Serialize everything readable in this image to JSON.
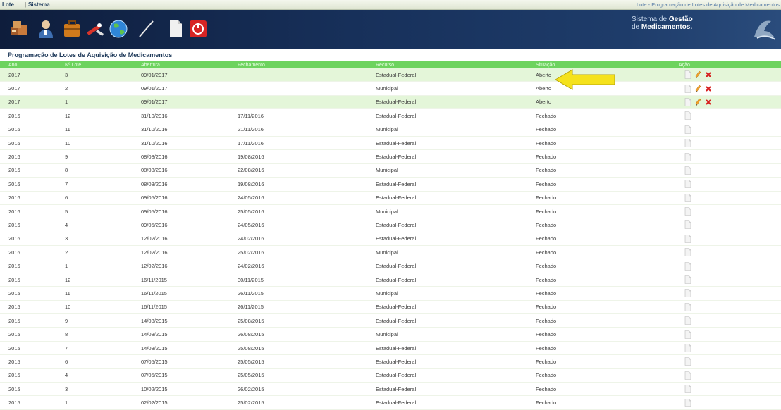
{
  "menu": {
    "items": [
      "Lote",
      "Sistema"
    ],
    "separator": "|"
  },
  "breadcrumb": "Lote - Programação de Lotes de Aquisição de Medicamentos",
  "brand": {
    "line1a": "Sistema de ",
    "line1b": "Gestão",
    "line2a": "de ",
    "line2b": "Medicamentos."
  },
  "toolbar": [
    "boxes-icon",
    "user-icon",
    "briefcase-icon",
    "tools-icon",
    "globe-icon",
    "pen-icon",
    "document-icon",
    "power-icon"
  ],
  "page_title": "Programação de Lotes de Aquisição de Medicamentos",
  "table": {
    "headers": [
      "Ano",
      "Nº Lote",
      "Abertura",
      "Fechamento",
      "Recurso",
      "Situação",
      "Ação"
    ],
    "rows": [
      {
        "ano": "2017",
        "lote": "3",
        "abertura": "09/01/2017",
        "fechamento": "",
        "recurso": "Estadual-Federal",
        "situacao": "Aberto",
        "acoes": [
          "doc",
          "edit",
          "delete"
        ],
        "hl": true
      },
      {
        "ano": "2017",
        "lote": "2",
        "abertura": "09/01/2017",
        "fechamento": "",
        "recurso": "Municipal",
        "situacao": "Aberto",
        "acoes": [
          "doc",
          "edit",
          "delete"
        ],
        "hl": false
      },
      {
        "ano": "2017",
        "lote": "1",
        "abertura": "09/01/2017",
        "fechamento": "",
        "recurso": "Estadual-Federal",
        "situacao": "Aberto",
        "acoes": [
          "doc",
          "edit",
          "delete"
        ],
        "hl": true
      },
      {
        "ano": "2016",
        "lote": "12",
        "abertura": "31/10/2016",
        "fechamento": "17/11/2016",
        "recurso": "Estadual-Federal",
        "situacao": "Fechado",
        "acoes": [
          "doc"
        ],
        "hl": false
      },
      {
        "ano": "2016",
        "lote": "11",
        "abertura": "31/10/2016",
        "fechamento": "21/11/2016",
        "recurso": "Municipal",
        "situacao": "Fechado",
        "acoes": [
          "doc"
        ],
        "hl": false
      },
      {
        "ano": "2016",
        "lote": "10",
        "abertura": "31/10/2016",
        "fechamento": "17/11/2016",
        "recurso": "Estadual-Federal",
        "situacao": "Fechado",
        "acoes": [
          "doc"
        ],
        "hl": false
      },
      {
        "ano": "2016",
        "lote": "9",
        "abertura": "08/08/2016",
        "fechamento": "19/08/2016",
        "recurso": "Estadual-Federal",
        "situacao": "Fechado",
        "acoes": [
          "doc"
        ],
        "hl": false
      },
      {
        "ano": "2016",
        "lote": "8",
        "abertura": "08/08/2016",
        "fechamento": "22/08/2016",
        "recurso": "Municipal",
        "situacao": "Fechado",
        "acoes": [
          "doc"
        ],
        "hl": false
      },
      {
        "ano": "2016",
        "lote": "7",
        "abertura": "08/08/2016",
        "fechamento": "19/08/2016",
        "recurso": "Estadual-Federal",
        "situacao": "Fechado",
        "acoes": [
          "doc"
        ],
        "hl": false
      },
      {
        "ano": "2016",
        "lote": "6",
        "abertura": "09/05/2016",
        "fechamento": "24/05/2016",
        "recurso": "Estadual-Federal",
        "situacao": "Fechado",
        "acoes": [
          "doc"
        ],
        "hl": false
      },
      {
        "ano": "2016",
        "lote": "5",
        "abertura": "09/05/2016",
        "fechamento": "25/05/2016",
        "recurso": "Municipal",
        "situacao": "Fechado",
        "acoes": [
          "doc"
        ],
        "hl": false
      },
      {
        "ano": "2016",
        "lote": "4",
        "abertura": "09/05/2016",
        "fechamento": "24/05/2016",
        "recurso": "Estadual-Federal",
        "situacao": "Fechado",
        "acoes": [
          "doc"
        ],
        "hl": false
      },
      {
        "ano": "2016",
        "lote": "3",
        "abertura": "12/02/2016",
        "fechamento": "24/02/2016",
        "recurso": "Estadual-Federal",
        "situacao": "Fechado",
        "acoes": [
          "doc"
        ],
        "hl": false
      },
      {
        "ano": "2016",
        "lote": "2",
        "abertura": "12/02/2016",
        "fechamento": "25/02/2016",
        "recurso": "Municipal",
        "situacao": "Fechado",
        "acoes": [
          "doc"
        ],
        "hl": false
      },
      {
        "ano": "2016",
        "lote": "1",
        "abertura": "12/02/2016",
        "fechamento": "24/02/2016",
        "recurso": "Estadual-Federal",
        "situacao": "Fechado",
        "acoes": [
          "doc"
        ],
        "hl": false
      },
      {
        "ano": "2015",
        "lote": "12",
        "abertura": "16/11/2015",
        "fechamento": "30/11/2015",
        "recurso": "Estadual-Federal",
        "situacao": "Fechado",
        "acoes": [
          "doc"
        ],
        "hl": false
      },
      {
        "ano": "2015",
        "lote": "11",
        "abertura": "16/11/2015",
        "fechamento": "26/11/2015",
        "recurso": "Municipal",
        "situacao": "Fechado",
        "acoes": [
          "doc"
        ],
        "hl": false
      },
      {
        "ano": "2015",
        "lote": "10",
        "abertura": "16/11/2015",
        "fechamento": "26/11/2015",
        "recurso": "Estadual-Federal",
        "situacao": "Fechado",
        "acoes": [
          "doc"
        ],
        "hl": false
      },
      {
        "ano": "2015",
        "lote": "9",
        "abertura": "14/08/2015",
        "fechamento": "25/08/2015",
        "recurso": "Estadual-Federal",
        "situacao": "Fechado",
        "acoes": [
          "doc"
        ],
        "hl": false
      },
      {
        "ano": "2015",
        "lote": "8",
        "abertura": "14/08/2015",
        "fechamento": "26/08/2015",
        "recurso": "Municipal",
        "situacao": "Fechado",
        "acoes": [
          "doc"
        ],
        "hl": false
      },
      {
        "ano": "2015",
        "lote": "7",
        "abertura": "14/08/2015",
        "fechamento": "25/08/2015",
        "recurso": "Estadual-Federal",
        "situacao": "Fechado",
        "acoes": [
          "doc"
        ],
        "hl": false
      },
      {
        "ano": "2015",
        "lote": "6",
        "abertura": "07/05/2015",
        "fechamento": "25/05/2015",
        "recurso": "Estadual-Federal",
        "situacao": "Fechado",
        "acoes": [
          "doc"
        ],
        "hl": false
      },
      {
        "ano": "2015",
        "lote": "4",
        "abertura": "07/05/2015",
        "fechamento": "25/05/2015",
        "recurso": "Estadual-Federal",
        "situacao": "Fechado",
        "acoes": [
          "doc"
        ],
        "hl": false
      },
      {
        "ano": "2015",
        "lote": "3",
        "abertura": "10/02/2015",
        "fechamento": "26/02/2015",
        "recurso": "Estadual-Federal",
        "situacao": "Fechado",
        "acoes": [
          "doc"
        ],
        "hl": false
      },
      {
        "ano": "2015",
        "lote": "1",
        "abertura": "02/02/2015",
        "fechamento": "25/02/2015",
        "recurso": "Estadual-Federal",
        "situacao": "Fechado",
        "acoes": [
          "doc"
        ],
        "hl": false
      }
    ]
  },
  "colors": {
    "header_green": "#6dd35e",
    "highlight_row": "#e4f6d9",
    "banner": "#17305a",
    "arrow": "#f5e21c"
  },
  "annotation": {
    "type": "arrow",
    "points_to": "situacao-aberto-row-1"
  }
}
